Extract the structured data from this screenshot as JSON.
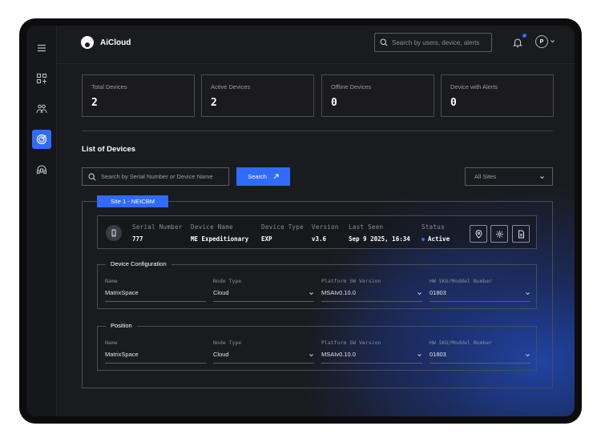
{
  "app": {
    "name": "AiCloud"
  },
  "sidebar": {
    "items": [
      {
        "icon": "menu-icon"
      },
      {
        "icon": "dashboard-icon"
      },
      {
        "icon": "users-icon"
      },
      {
        "icon": "devices-icon",
        "active": true
      },
      {
        "icon": "support-icon"
      }
    ]
  },
  "topbar": {
    "search_placeholder": "Search by users, device, alerts",
    "avatar_initial": "P"
  },
  "stats": [
    {
      "label": "Total Devices",
      "value": "2"
    },
    {
      "label": "Active Devices",
      "value": "2"
    },
    {
      "label": "Offline Devices",
      "value": "0"
    },
    {
      "label": "Device with Alerts",
      "value": "0"
    }
  ],
  "devices": {
    "title": "List of Devices",
    "search_placeholder": "Search by Serial Number or Device Name",
    "search_button": "Search",
    "site_filter": "All Sites"
  },
  "site": {
    "tag": "Site 1 - NEICBM",
    "device": {
      "columns": [
        {
          "header": "Serial Number",
          "value": "777"
        },
        {
          "header": "Device Name",
          "value": "ME Expeditionary"
        },
        {
          "header": "Device Type",
          "value": "EXP"
        },
        {
          "header": "Version",
          "value": "v3.6"
        },
        {
          "header": "Last Seen",
          "value": "Sep 9 2025, 16:34"
        },
        {
          "header": "Status",
          "value": "Active"
        }
      ]
    },
    "config": {
      "legend": "Device Configuration",
      "fields": [
        {
          "label": "Name",
          "value": "MatrixSpace"
        },
        {
          "label": "Node Type",
          "value": "Cloud"
        },
        {
          "label": "Platform SW Version",
          "value": "MSAIv0.10.0"
        },
        {
          "label": "HW SKU/Moddel Number",
          "value": "01803"
        }
      ]
    },
    "position": {
      "legend": "Position",
      "fields": [
        {
          "label": "Name",
          "value": "MatrixSpace"
        },
        {
          "label": "Node Type",
          "value": "Cloud"
        },
        {
          "label": "Platform SW Version",
          "value": "MSAIv0.10.0"
        },
        {
          "label": "HW SKU/Moddel Number",
          "value": "01803"
        }
      ]
    }
  },
  "colors": {
    "accent": "#2f6bff",
    "background": "#1a1b1f"
  }
}
